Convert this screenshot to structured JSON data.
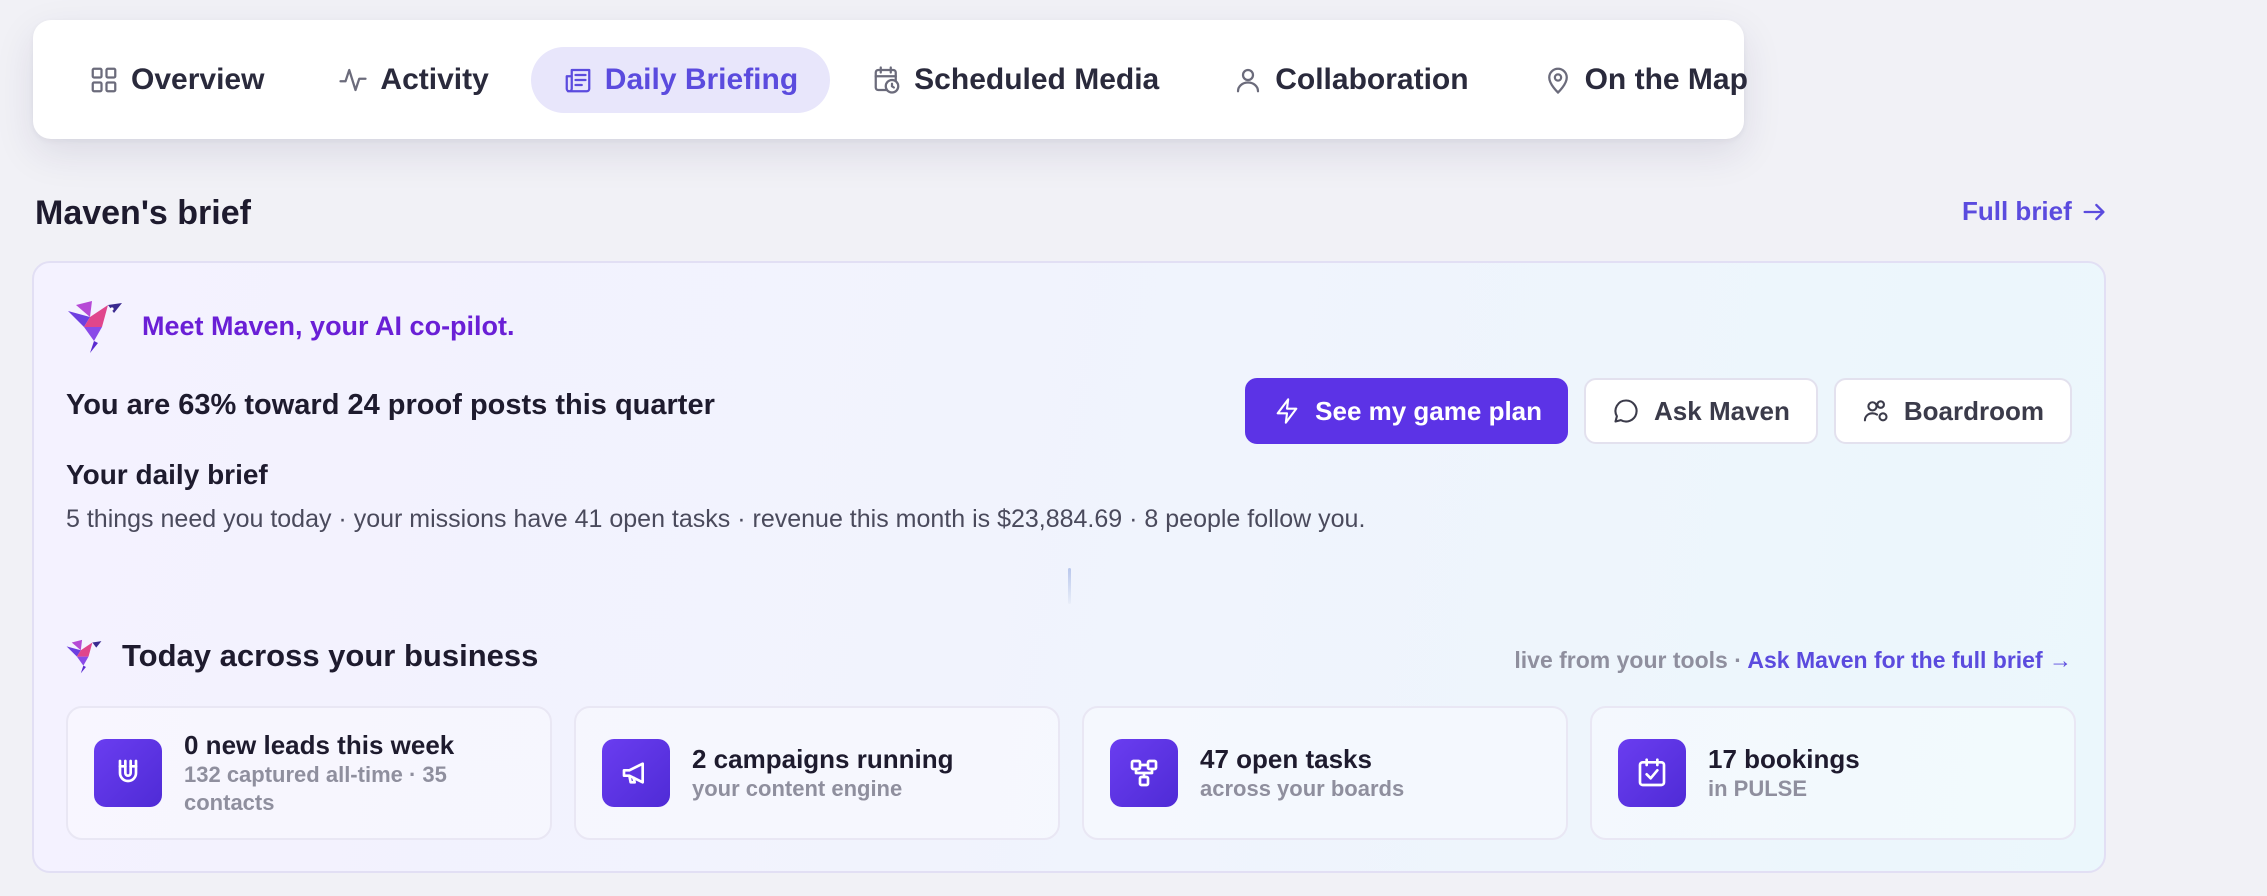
{
  "tabs": [
    {
      "label": "Overview",
      "icon": "grid-icon",
      "active": false
    },
    {
      "label": "Activity",
      "icon": "activity-icon",
      "active": false
    },
    {
      "label": "Daily Briefing",
      "icon": "newspaper-icon",
      "active": true
    },
    {
      "label": "Scheduled Media",
      "icon": "calendar-clock-icon",
      "active": false
    },
    {
      "label": "Collaboration",
      "icon": "user-icon",
      "active": false
    },
    {
      "label": "On the Map",
      "icon": "map-pin-icon",
      "active": false
    }
  ],
  "section": {
    "title": "Maven's brief",
    "full_brief_label": "Full brief"
  },
  "brief": {
    "intro": "Meet Maven, your AI co-pilot.",
    "progress_text": "You are 63% toward 24 proof posts this quarter",
    "daily_title": "Your daily brief",
    "daily_text": "5 things need you today · your missions have 41 open tasks · revenue this month is $23,884.69 · 8 people follow you.",
    "actions": {
      "primary": "See my game plan",
      "ask": "Ask Maven",
      "boardroom": "Boardroom"
    }
  },
  "today": {
    "title": "Today across your business",
    "live_prefix": "live from your tools · ",
    "ask_link": "Ask Maven for the full brief →",
    "stats": [
      {
        "title": "0 new leads this week",
        "sub": "132 captured all-time · 35 contacts",
        "icon": "magnet-icon"
      },
      {
        "title": "2 campaigns running",
        "sub": "your content engine",
        "icon": "megaphone-icon"
      },
      {
        "title": "47 open tasks",
        "sub": "across your boards",
        "icon": "workflow-icon"
      },
      {
        "title": "17 bookings",
        "sub": "in PULSE",
        "icon": "calendar-check-icon"
      }
    ]
  },
  "colors": {
    "accent": "#5b4bde",
    "primary_button": "#5c33e6",
    "maven_purple": "#6a1fd6"
  }
}
